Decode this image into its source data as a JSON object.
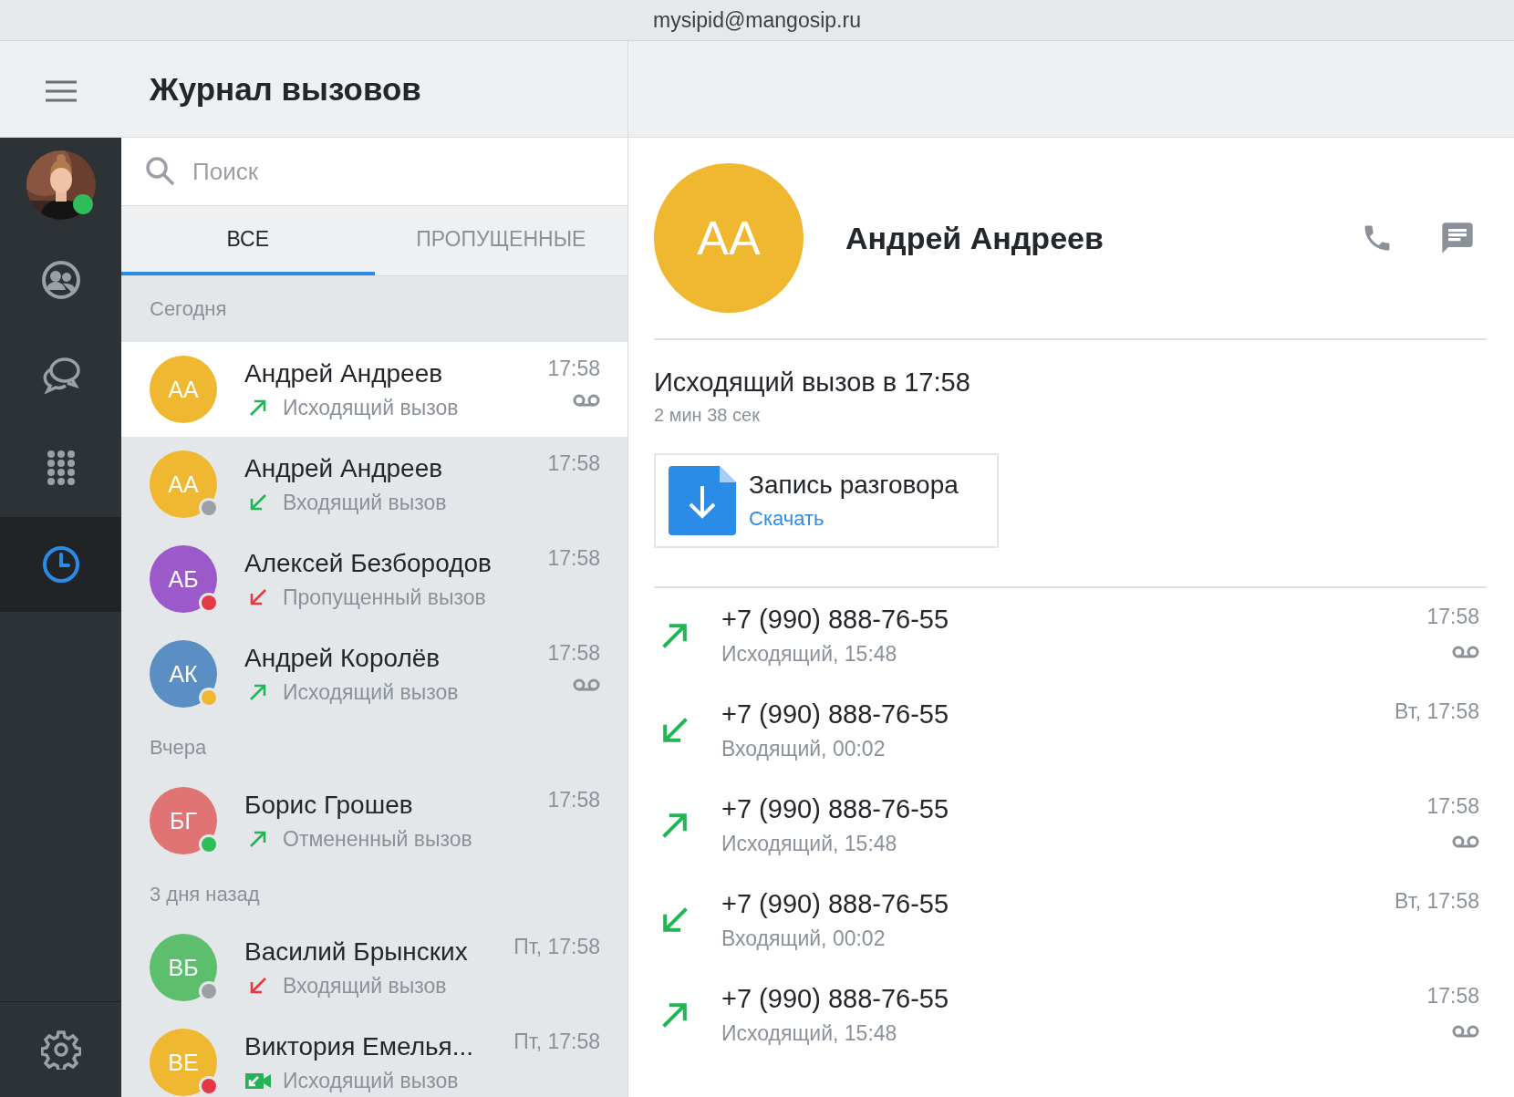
{
  "window": {
    "title": "mysipid@mangosip.ru"
  },
  "header": {
    "title": "Журнал вызовов"
  },
  "sidebar": {
    "user": {
      "presence": {
        "color": "#2ebd59"
      }
    },
    "items": [
      {
        "kind": "contacts",
        "selected": false
      },
      {
        "kind": "chats",
        "selected": false
      },
      {
        "kind": "dialpad",
        "selected": false
      },
      {
        "kind": "history",
        "selected": true
      }
    ]
  },
  "search": {
    "placeholder": "Поиск"
  },
  "tabs": [
    {
      "label": "ВСЕ",
      "selected": true
    },
    {
      "label": "ПРОПУЩЕННЫЕ",
      "selected": false
    }
  ],
  "call_log": [
    {
      "heading": "Сегодня",
      "calls": [
        {
          "avatar": {
            "initials": "АА",
            "color": "#f0b731"
          },
          "name": "Андрей Андреев",
          "time": "17:58",
          "kind": "outgoing",
          "missed": false,
          "status": "Исходящий вызов",
          "voicemail": true,
          "selected": true
        },
        {
          "avatar": {
            "initials": "АА",
            "color": "#f0b731"
          },
          "presence": {
            "color": "#9aa0a6"
          },
          "name": "Андрей Андреев",
          "time": "17:58",
          "kind": "incoming",
          "missed": false,
          "status": "Входящий вызов",
          "voicemail": false,
          "selected": false
        },
        {
          "avatar": {
            "initials": "АБ",
            "color": "#9b59c9"
          },
          "presence": {
            "color": "#e53945"
          },
          "name": "Алексей Безбородов",
          "time": "17:58",
          "kind": "incoming",
          "missed": true,
          "status": "Пропущенный вызов",
          "voicemail": false,
          "selected": false
        },
        {
          "avatar": {
            "initials": "АК",
            "color": "#5b8fc4"
          },
          "presence": {
            "color": "#f0b731"
          },
          "name": "Андрей Королёв",
          "time": "17:58",
          "kind": "outgoing",
          "missed": false,
          "status": "Исходящий вызов",
          "voicemail": true,
          "selected": false
        }
      ]
    },
    {
      "heading": "Вчера",
      "calls": [
        {
          "avatar": {
            "initials": "БГ",
            "color": "#e07474"
          },
          "presence": {
            "color": "#2ebd59"
          },
          "name": "Борис Грошев",
          "time": "17:58",
          "kind": "outgoing",
          "missed": false,
          "status": "Отмененный вызов",
          "voicemail": false,
          "selected": false
        }
      ]
    },
    {
      "heading": "3 дня назад",
      "calls": [
        {
          "avatar": {
            "initials": "ВБ",
            "color": "#5dbf6e"
          },
          "presence": {
            "color": "#9aa0a6"
          },
          "name": "Василий Брынских",
          "time": "Пт, 17:58",
          "kind": "incoming",
          "missed": true,
          "status": "Входящий вызов",
          "voicemail": false,
          "selected": false
        },
        {
          "avatar": {
            "initials": "ВЕ",
            "color": "#f0b731"
          },
          "presence": {
            "color": "#e53945"
          },
          "name": "Виктория Емелья...",
          "time": "Пт, 17:58",
          "kind": "video",
          "missed": false,
          "status": "Исходящий вызов",
          "voicemail": false,
          "selected": false
        }
      ]
    }
  ],
  "detail": {
    "avatar": {
      "initials": "АА",
      "color": "#f0b731"
    },
    "name": "Андрей Андреев",
    "summary": "Исходящий вызов в 17:58",
    "duration": "2 мин 38 сек",
    "recording": {
      "title": "Запись разговора",
      "link": "Скачать"
    },
    "history": [
      {
        "kind": "outgoing",
        "number": "+7 (990) 888-76-55",
        "detail": "Исходящий, 15:48",
        "time": "17:58",
        "voicemail": true
      },
      {
        "kind": "incoming",
        "number": "+7 (990) 888-76-55",
        "detail": "Входящий, 00:02",
        "time": "Вт, 17:58",
        "voicemail": false
      },
      {
        "kind": "outgoing",
        "number": "+7 (990) 888-76-55",
        "detail": "Исходящий, 15:48",
        "time": "17:58",
        "voicemail": true
      },
      {
        "kind": "incoming",
        "number": "+7 (990) 888-76-55",
        "detail": "Входящий, 00:02",
        "time": "Вт, 17:58",
        "voicemail": false
      },
      {
        "kind": "outgoing",
        "number": "+7 (990) 888-76-55",
        "detail": "Исходящий, 15:48",
        "time": "17:58",
        "voicemail": true
      }
    ]
  }
}
